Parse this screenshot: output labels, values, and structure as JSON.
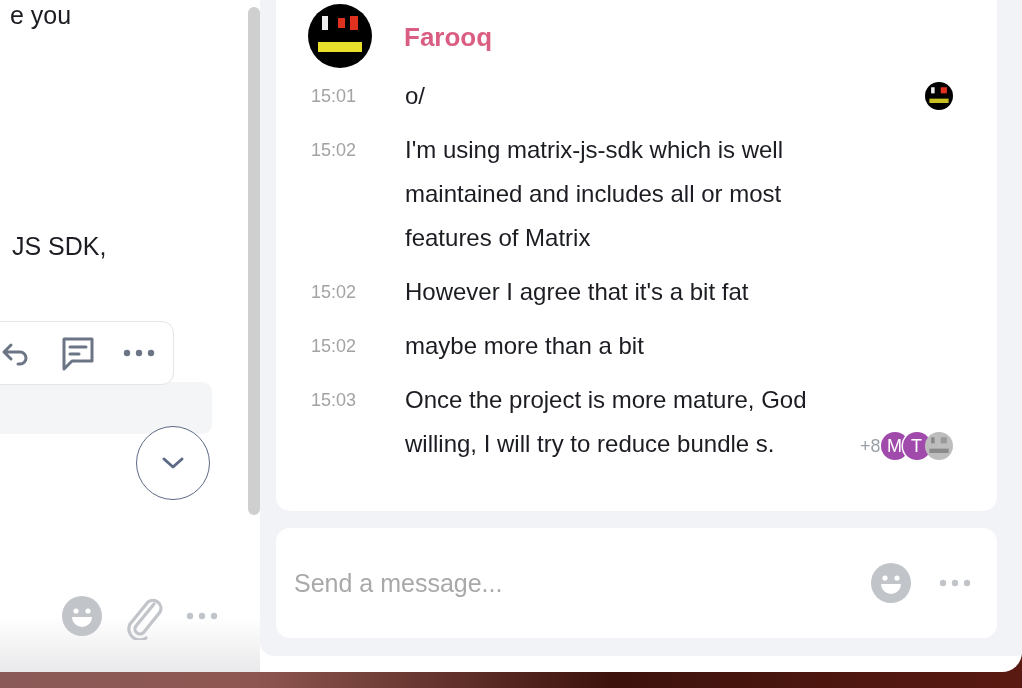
{
  "left_pane": {
    "text_fragments": [
      "e you",
      "JS SDK,"
    ]
  },
  "timeline": {
    "sender": {
      "name": "Farooq",
      "color": "#d95e82"
    },
    "messages": [
      {
        "time": "15:01",
        "text": "o/",
        "receipts": [
          {
            "kind": "image"
          }
        ]
      },
      {
        "time": "15:02",
        "text": "I'm using matrix-js-sdk which is well maintained and includes all or most features of Matrix"
      },
      {
        "time": "15:02",
        "text": "However I agree that it's a bit fat"
      },
      {
        "time": "15:02",
        "text": "maybe more than a bit"
      },
      {
        "time": "15:03",
        "text": "Once the project is more mature, God willing, I will try to reduce bundle s.",
        "receipts_more": "+8",
        "receipts": [
          {
            "kind": "letter",
            "letter": "M",
            "color": "#a04aac"
          },
          {
            "kind": "letter",
            "letter": "T",
            "color": "#a04aac"
          },
          {
            "kind": "image"
          }
        ]
      }
    ]
  },
  "composer": {
    "placeholder": "Send a message..."
  }
}
